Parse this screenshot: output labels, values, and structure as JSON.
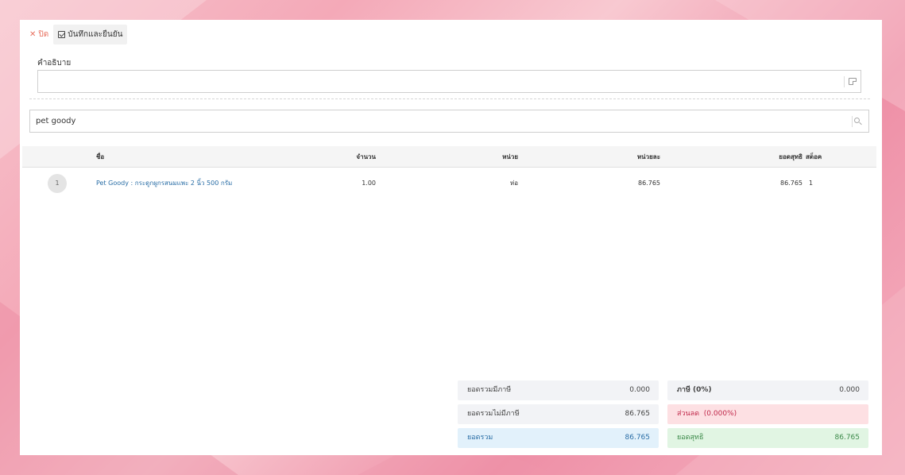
{
  "toolbar": {
    "close_label": "ปิด",
    "save_label": "บันทึกและยืนยัน"
  },
  "description": {
    "label": "คำอธิบาย",
    "value": ""
  },
  "search": {
    "value": "pet goody"
  },
  "table": {
    "columns": {
      "name": "ชื่อ",
      "quantity": "จำนวน",
      "unit": "หน่วย",
      "unit_price": "หน่วยละ",
      "net": "ยอดสุทธิ",
      "stock": "สต็อค"
    },
    "rows": [
      {
        "index": "1",
        "name": "Pet Goody : กระดูกผูกรสนมแพะ 2 นิ้ว 500 กรัม",
        "quantity": "1.00",
        "unit": "ห่อ",
        "unit_price": "86.765",
        "net": "86.765",
        "stock": "1"
      }
    ]
  },
  "summary": {
    "taxed_total": {
      "label": "ยอดรวมมีภาษี",
      "value": "0.000"
    },
    "tax": {
      "label": "ภาษี (0%)",
      "value": "0.000"
    },
    "untaxed_total": {
      "label": "ยอดรวมไม่มีภาษี",
      "value": "86.765"
    },
    "discount": {
      "label": "ส่วนลด",
      "percent": "(0.000%)"
    },
    "total": {
      "label": "ยอดรวม",
      "value": "86.765"
    },
    "net_total": {
      "label": "ยอดสุทธิ",
      "value": "86.765"
    }
  },
  "colors": {
    "background": "#f4a9b8",
    "close_accent": "#e8705f",
    "link": "#2a6ea6",
    "discount_text": "#c0284a",
    "net_text": "#3c8a4a"
  }
}
